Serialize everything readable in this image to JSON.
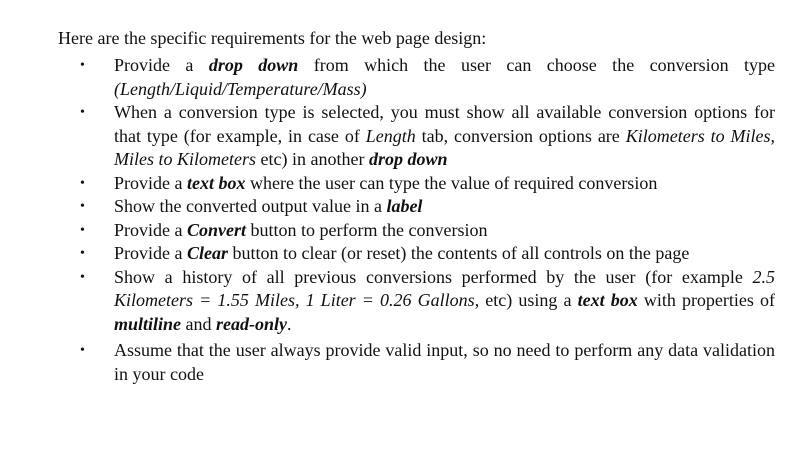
{
  "intro": "Here are the specific requirements for the web page design:",
  "bullet_glyph": "•",
  "items": [
    {
      "parts": [
        {
          "t": "Provide a ",
          "s": ""
        },
        {
          "t": "drop down",
          "s": "bi"
        },
        {
          "t": " from which the user can choose the conversion type ",
          "s": ""
        },
        {
          "t": "(Length/Liquid/Temperature/Mass)",
          "s": "it"
        }
      ]
    },
    {
      "parts": [
        {
          "t": "When a conversion type is selected, you must show all available conversion options for that type (for example, in case of ",
          "s": ""
        },
        {
          "t": "Length",
          "s": "it"
        },
        {
          "t": " tab, conversion options are ",
          "s": ""
        },
        {
          "t": "Kilometers to Miles, Miles to Kilometers",
          "s": "it"
        },
        {
          "t": " etc) in another ",
          "s": ""
        },
        {
          "t": "drop down",
          "s": "bi"
        }
      ]
    },
    {
      "parts": [
        {
          "t": "Provide a ",
          "s": ""
        },
        {
          "t": "text box",
          "s": "bi"
        },
        {
          "t": " where the user can type the value of required conversion",
          "s": ""
        }
      ]
    },
    {
      "parts": [
        {
          "t": "Show the converted output value in a ",
          "s": ""
        },
        {
          "t": "label",
          "s": "bi"
        }
      ]
    },
    {
      "parts": [
        {
          "t": "Provide a ",
          "s": ""
        },
        {
          "t": "Convert",
          "s": "bi"
        },
        {
          "t": " button to perform the conversion",
          "s": ""
        }
      ]
    },
    {
      "parts": [
        {
          "t": "Provide a ",
          "s": ""
        },
        {
          "t": "Clear",
          "s": "bi"
        },
        {
          "t": " button to clear (or reset) the contents of all controls on the page",
          "s": ""
        }
      ]
    },
    {
      "parts": [
        {
          "t": "Show a history of all previous conversions performed by the user (for example ",
          "s": ""
        },
        {
          "t": "2.5 Kilometers = 1.55 Miles, 1 Liter = 0.26 Gallons",
          "s": "it"
        },
        {
          "t": ", etc) using a ",
          "s": ""
        },
        {
          "t": "text box",
          "s": "bi"
        },
        {
          "t": " with properties of ",
          "s": ""
        },
        {
          "t": "multiline",
          "s": "bi"
        },
        {
          "t": " and ",
          "s": ""
        },
        {
          "t": "read-only",
          "s": "bi"
        },
        {
          "t": ".",
          "s": ""
        }
      ]
    },
    {
      "parts": [
        {
          "t": "Assume that the user always provide valid input, so no need to perform any data validation in your code",
          "s": ""
        }
      ]
    }
  ]
}
